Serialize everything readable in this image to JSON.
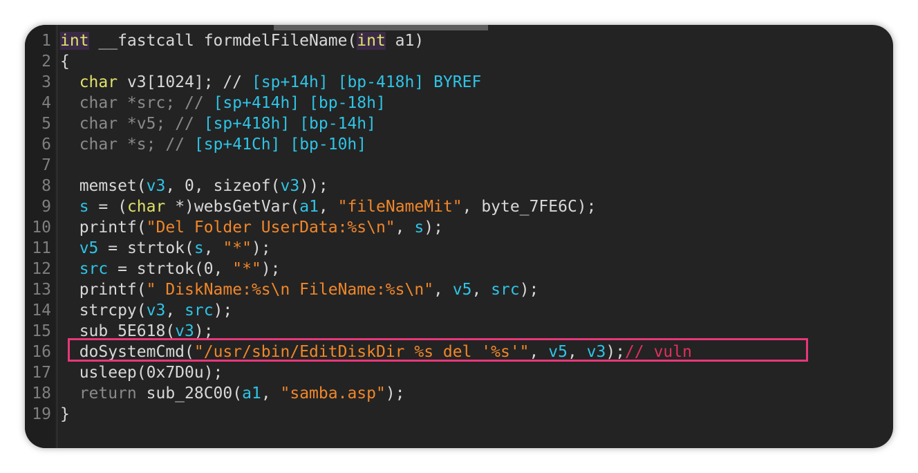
{
  "colors": {
    "background": "#232323",
    "keyword": "#e1e16a",
    "variable": "#2ec4e6",
    "string": "#f0872a",
    "comment_vuln": "#e0305f",
    "highlight_border": "#e8377a"
  },
  "lines": [
    {
      "n": "1",
      "t": [
        {
          "c": "kw",
          "s": "int"
        },
        {
          "c": "id",
          "s": " __fastcall formdelFileName("
        },
        {
          "c": "kw",
          "s": "int"
        },
        {
          "c": "id",
          "s": " a1)"
        }
      ]
    },
    {
      "n": "2",
      "t": [
        {
          "c": "id",
          "s": "{"
        }
      ]
    },
    {
      "n": "3",
      "t": [
        {
          "c": "id",
          "s": "  "
        },
        {
          "c": "kw-plain",
          "s": "char"
        },
        {
          "c": "id",
          "s": " v3[1024]; // "
        },
        {
          "c": "cyan",
          "s": "[sp+14h] [bp-418h] BYREF"
        }
      ]
    },
    {
      "n": "4",
      "t": [
        {
          "c": "gray",
          "s": "  char *src; // "
        },
        {
          "c": "cyan",
          "s": "[sp+414h] [bp-18h]"
        }
      ]
    },
    {
      "n": "5",
      "t": [
        {
          "c": "gray",
          "s": "  char *v5; // "
        },
        {
          "c": "cyan",
          "s": "[sp+418h] [bp-14h]"
        }
      ]
    },
    {
      "n": "6",
      "t": [
        {
          "c": "gray",
          "s": "  char *s; // "
        },
        {
          "c": "cyan",
          "s": "[sp+41Ch] [bp-10h]"
        }
      ]
    },
    {
      "n": "7",
      "t": []
    },
    {
      "n": "8",
      "t": [
        {
          "c": "id",
          "s": "  memset("
        },
        {
          "c": "cyan",
          "s": "v3"
        },
        {
          "c": "id",
          "s": ", 0, sizeof("
        },
        {
          "c": "cyan",
          "s": "v3"
        },
        {
          "c": "id",
          "s": "));"
        }
      ]
    },
    {
      "n": "9",
      "t": [
        {
          "c": "id",
          "s": "  "
        },
        {
          "c": "cyan",
          "s": "s"
        },
        {
          "c": "id",
          "s": " = ("
        },
        {
          "c": "kw-plain",
          "s": "char"
        },
        {
          "c": "id",
          "s": " *)websGetVar("
        },
        {
          "c": "cyan",
          "s": "a1"
        },
        {
          "c": "id",
          "s": ", "
        },
        {
          "c": "str",
          "s": "\"fileNameMit\""
        },
        {
          "c": "id",
          "s": ", byte_7FE6C);"
        }
      ]
    },
    {
      "n": "10",
      "t": [
        {
          "c": "id",
          "s": "  printf("
        },
        {
          "c": "str",
          "s": "\"Del Folder UserData:%s\\n\""
        },
        {
          "c": "id",
          "s": ", "
        },
        {
          "c": "cyan",
          "s": "s"
        },
        {
          "c": "id",
          "s": ");"
        }
      ]
    },
    {
      "n": "11",
      "t": [
        {
          "c": "id",
          "s": "  "
        },
        {
          "c": "cyan",
          "s": "v5"
        },
        {
          "c": "id",
          "s": " = strtok("
        },
        {
          "c": "cyan",
          "s": "s"
        },
        {
          "c": "id",
          "s": ", "
        },
        {
          "c": "str",
          "s": "\"*\""
        },
        {
          "c": "id",
          "s": ");"
        }
      ]
    },
    {
      "n": "12",
      "t": [
        {
          "c": "id",
          "s": "  "
        },
        {
          "c": "cyan",
          "s": "src"
        },
        {
          "c": "id",
          "s": " = strtok(0, "
        },
        {
          "c": "str",
          "s": "\"*\""
        },
        {
          "c": "id",
          "s": ");"
        }
      ]
    },
    {
      "n": "13",
      "t": [
        {
          "c": "id",
          "s": "  printf("
        },
        {
          "c": "str",
          "s": "\" DiskName:%s\\n FileName:%s\\n\""
        },
        {
          "c": "id",
          "s": ", "
        },
        {
          "c": "cyan",
          "s": "v5"
        },
        {
          "c": "id",
          "s": ", "
        },
        {
          "c": "cyan",
          "s": "src"
        },
        {
          "c": "id",
          "s": ");"
        }
      ]
    },
    {
      "n": "14",
      "t": [
        {
          "c": "id",
          "s": "  strcpy("
        },
        {
          "c": "cyan",
          "s": "v3"
        },
        {
          "c": "id",
          "s": ", "
        },
        {
          "c": "cyan",
          "s": "src"
        },
        {
          "c": "id",
          "s": ");"
        }
      ]
    },
    {
      "n": "15",
      "t": [
        {
          "c": "id",
          "s": "  sub_5E618("
        },
        {
          "c": "cyan",
          "s": "v3"
        },
        {
          "c": "id",
          "s": ");"
        }
      ]
    },
    {
      "n": "16",
      "t": [
        {
          "c": "id",
          "s": "  doSystemCmd("
        },
        {
          "c": "str",
          "s": "\"/usr/sbin/EditDiskDir %s del '%s'\""
        },
        {
          "c": "id",
          "s": ", "
        },
        {
          "c": "cyan",
          "s": "v5"
        },
        {
          "c": "id",
          "s": ", "
        },
        {
          "c": "cyan",
          "s": "v3"
        },
        {
          "c": "id",
          "s": ");"
        },
        {
          "c": "vuln",
          "s": "// vuln"
        }
      ]
    },
    {
      "n": "17",
      "t": [
        {
          "c": "id",
          "s": "  usleep(0x7D0u);"
        }
      ]
    },
    {
      "n": "18",
      "t": [
        {
          "c": "gray",
          "s": "  return"
        },
        {
          "c": "id",
          "s": " sub_28C00("
        },
        {
          "c": "cyan",
          "s": "a1"
        },
        {
          "c": "id",
          "s": ", "
        },
        {
          "c": "str",
          "s": "\"samba.asp\""
        },
        {
          "c": "id",
          "s": ");"
        }
      ]
    },
    {
      "n": "19",
      "t": [
        {
          "c": "id",
          "s": "}"
        }
      ]
    }
  ]
}
